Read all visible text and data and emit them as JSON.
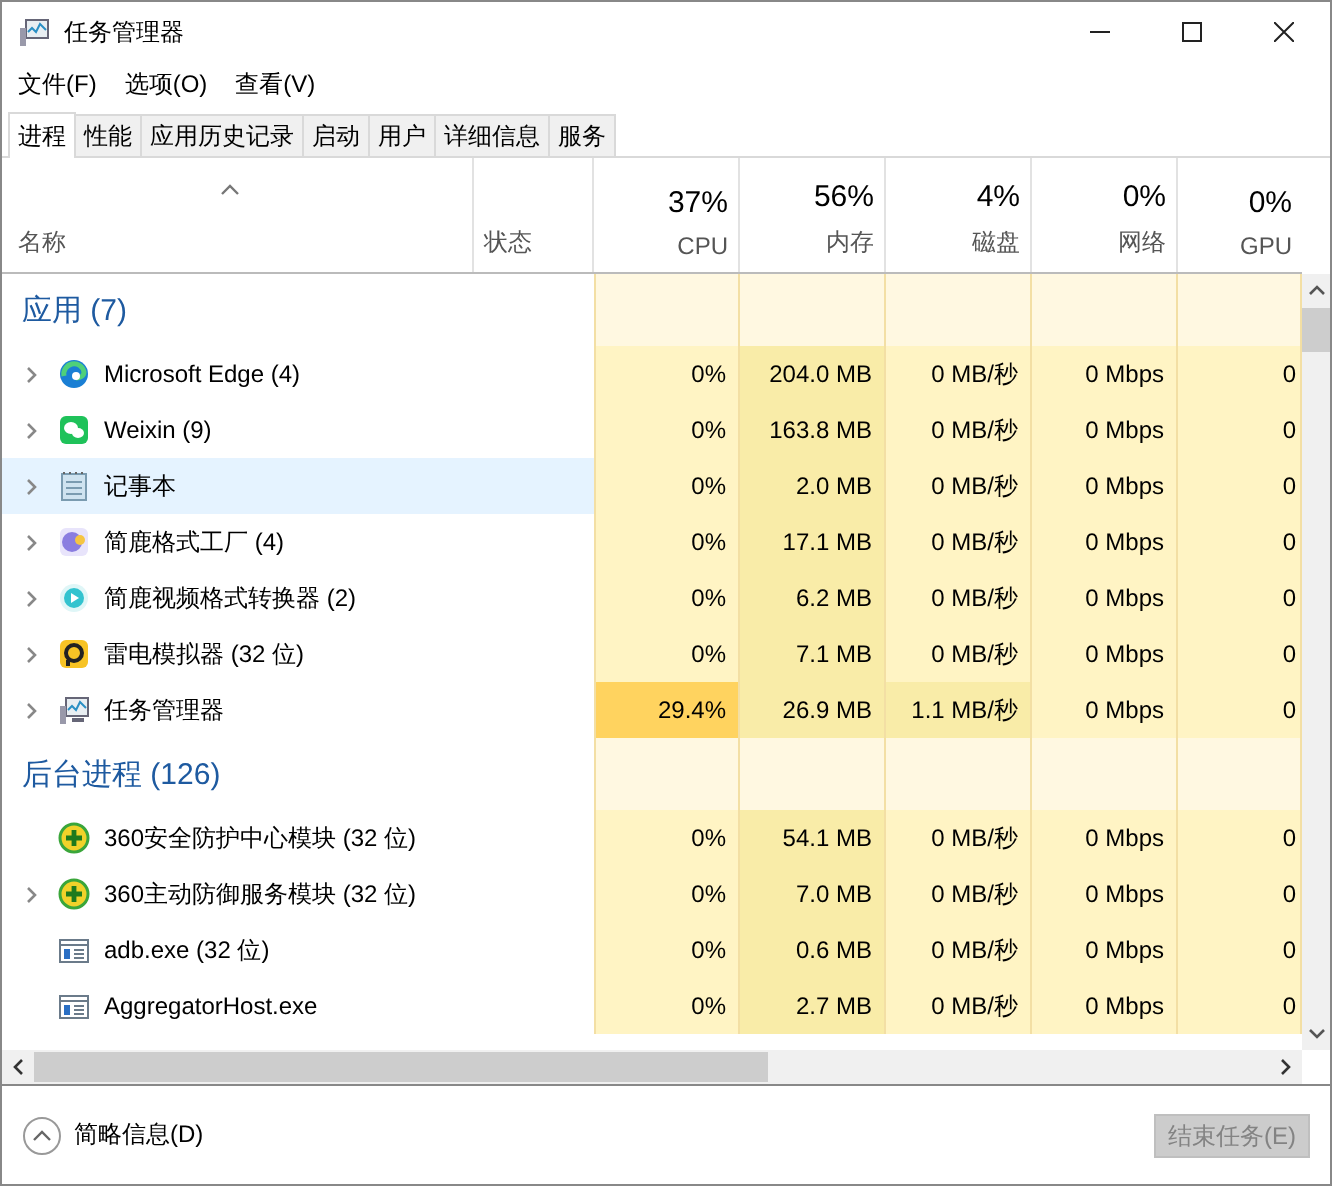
{
  "window": {
    "title": "任务管理器"
  },
  "menu": [
    "文件(F)",
    "选项(O)",
    "查看(V)"
  ],
  "tabs": [
    {
      "label": "进程",
      "selected": true
    },
    {
      "label": "性能",
      "selected": false
    },
    {
      "label": "应用历史记录",
      "selected": false
    },
    {
      "label": "启动",
      "selected": false
    },
    {
      "label": "用户",
      "selected": false
    },
    {
      "label": "详细信息",
      "selected": false
    },
    {
      "label": "服务",
      "selected": false
    }
  ],
  "table": {
    "columns": [
      {
        "label": "名称"
      },
      {
        "label": "状态"
      },
      {
        "percent": "37%",
        "label": "CPU"
      },
      {
        "percent": "56%",
        "label": "内存"
      },
      {
        "percent": "4%",
        "label": "磁盘"
      },
      {
        "percent": "0%",
        "label": "网络"
      },
      {
        "percent": "0%",
        "label": "GPU"
      }
    ],
    "groups": [
      {
        "title": "应用 (7)",
        "rows": [
          {
            "name": "Microsoft Edge (4)",
            "expandable": true,
            "selected": false,
            "cells": [
              {
                "text": "0%",
                "color": "#fff4c4"
              },
              {
                "text": "204.0 MB",
                "color": "#f9eca8"
              },
              {
                "text": "0 MB/秒",
                "color": "#fff4c4"
              },
              {
                "text": "0 Mbps",
                "color": "#fff4c4"
              },
              {
                "text": "0",
                "color": "#fff4c4"
              }
            ]
          },
          {
            "name": "Weixin (9)",
            "expandable": true,
            "selected": false,
            "cells": [
              {
                "text": "0%",
                "color": "#fff4c4"
              },
              {
                "text": "163.8 MB",
                "color": "#f9eca8"
              },
              {
                "text": "0 MB/秒",
                "color": "#fff4c4"
              },
              {
                "text": "0 Mbps",
                "color": "#fff4c4"
              },
              {
                "text": "0",
                "color": "#fff4c4"
              }
            ]
          },
          {
            "name": "记事本",
            "expandable": true,
            "selected": true,
            "cells": [
              {
                "text": "0%",
                "color": "#fff4c4"
              },
              {
                "text": "2.0 MB",
                "color": "#f9eca8"
              },
              {
                "text": "0 MB/秒",
                "color": "#fff4c4"
              },
              {
                "text": "0 Mbps",
                "color": "#fff4c4"
              },
              {
                "text": "0",
                "color": "#fff4c4"
              }
            ]
          },
          {
            "name": "简鹿格式工厂 (4)",
            "expandable": true,
            "selected": false,
            "cells": [
              {
                "text": "0%",
                "color": "#fff4c4"
              },
              {
                "text": "17.1 MB",
                "color": "#f9eca8"
              },
              {
                "text": "0 MB/秒",
                "color": "#fff4c4"
              },
              {
                "text": "0 Mbps",
                "color": "#fff4c4"
              },
              {
                "text": "0",
                "color": "#fff4c4"
              }
            ]
          },
          {
            "name": "简鹿视频格式转换器 (2)",
            "expandable": true,
            "selected": false,
            "cells": [
              {
                "text": "0%",
                "color": "#fff4c4"
              },
              {
                "text": "6.2 MB",
                "color": "#f9eca8"
              },
              {
                "text": "0 MB/秒",
                "color": "#fff4c4"
              },
              {
                "text": "0 Mbps",
                "color": "#fff4c4"
              },
              {
                "text": "0",
                "color": "#fff4c4"
              }
            ]
          },
          {
            "name": "雷电模拟器 (32 位)",
            "expandable": true,
            "selected": false,
            "cells": [
              {
                "text": "0%",
                "color": "#fff4c4"
              },
              {
                "text": "7.1 MB",
                "color": "#f9eca8"
              },
              {
                "text": "0 MB/秒",
                "color": "#fff4c4"
              },
              {
                "text": "0 Mbps",
                "color": "#fff4c4"
              },
              {
                "text": "0",
                "color": "#fff4c4"
              }
            ]
          },
          {
            "name": "任务管理器",
            "expandable": true,
            "selected": false,
            "cells": [
              {
                "text": "29.4%",
                "color": "#ffd35f"
              },
              {
                "text": "26.9 MB",
                "color": "#f9eca8"
              },
              {
                "text": "1.1 MB/秒",
                "color": "#f9eca8"
              },
              {
                "text": "0 Mbps",
                "color": "#fff4c4"
              },
              {
                "text": "0",
                "color": "#fff4c4"
              }
            ]
          }
        ]
      },
      {
        "title": "后台进程 (126)",
        "rows": [
          {
            "name": "360安全防护中心模块 (32 位)",
            "expandable": false,
            "selected": false,
            "cells": [
              {
                "text": "0%",
                "color": "#fff4c4"
              },
              {
                "text": "54.1 MB",
                "color": "#f9eca8"
              },
              {
                "text": "0 MB/秒",
                "color": "#fff4c4"
              },
              {
                "text": "0 Mbps",
                "color": "#fff4c4"
              },
              {
                "text": "0",
                "color": "#fff4c4"
              }
            ]
          },
          {
            "name": "360主动防御服务模块 (32 位)",
            "expandable": true,
            "selected": false,
            "cells": [
              {
                "text": "0%",
                "color": "#fff4c4"
              },
              {
                "text": "7.0 MB",
                "color": "#f9eca8"
              },
              {
                "text": "0 MB/秒",
                "color": "#fff4c4"
              },
              {
                "text": "0 Mbps",
                "color": "#fff4c4"
              },
              {
                "text": "0",
                "color": "#fff4c4"
              }
            ]
          },
          {
            "name": "adb.exe (32 位)",
            "expandable": false,
            "selected": false,
            "cells": [
              {
                "text": "0%",
                "color": "#fff4c4"
              },
              {
                "text": "0.6 MB",
                "color": "#f9eca8"
              },
              {
                "text": "0 MB/秒",
                "color": "#fff4c4"
              },
              {
                "text": "0 Mbps",
                "color": "#fff4c4"
              },
              {
                "text": "0",
                "color": "#fff4c4"
              }
            ]
          },
          {
            "name": "AggregatorHost.exe",
            "expandable": false,
            "selected": false,
            "cells": [
              {
                "text": "0%",
                "color": "#fff4c4"
              },
              {
                "text": "2.7 MB",
                "color": "#f9eca8"
              },
              {
                "text": "0 MB/秒",
                "color": "#fff4c4"
              },
              {
                "text": "0 Mbps",
                "color": "#fff4c4"
              },
              {
                "text": "0",
                "color": "#fff4c4"
              }
            ]
          }
        ]
      }
    ]
  },
  "footer": {
    "details_link": "简略信息(D)",
    "end_task": {
      "label": "结束任务(E)",
      "disabled": true
    }
  }
}
